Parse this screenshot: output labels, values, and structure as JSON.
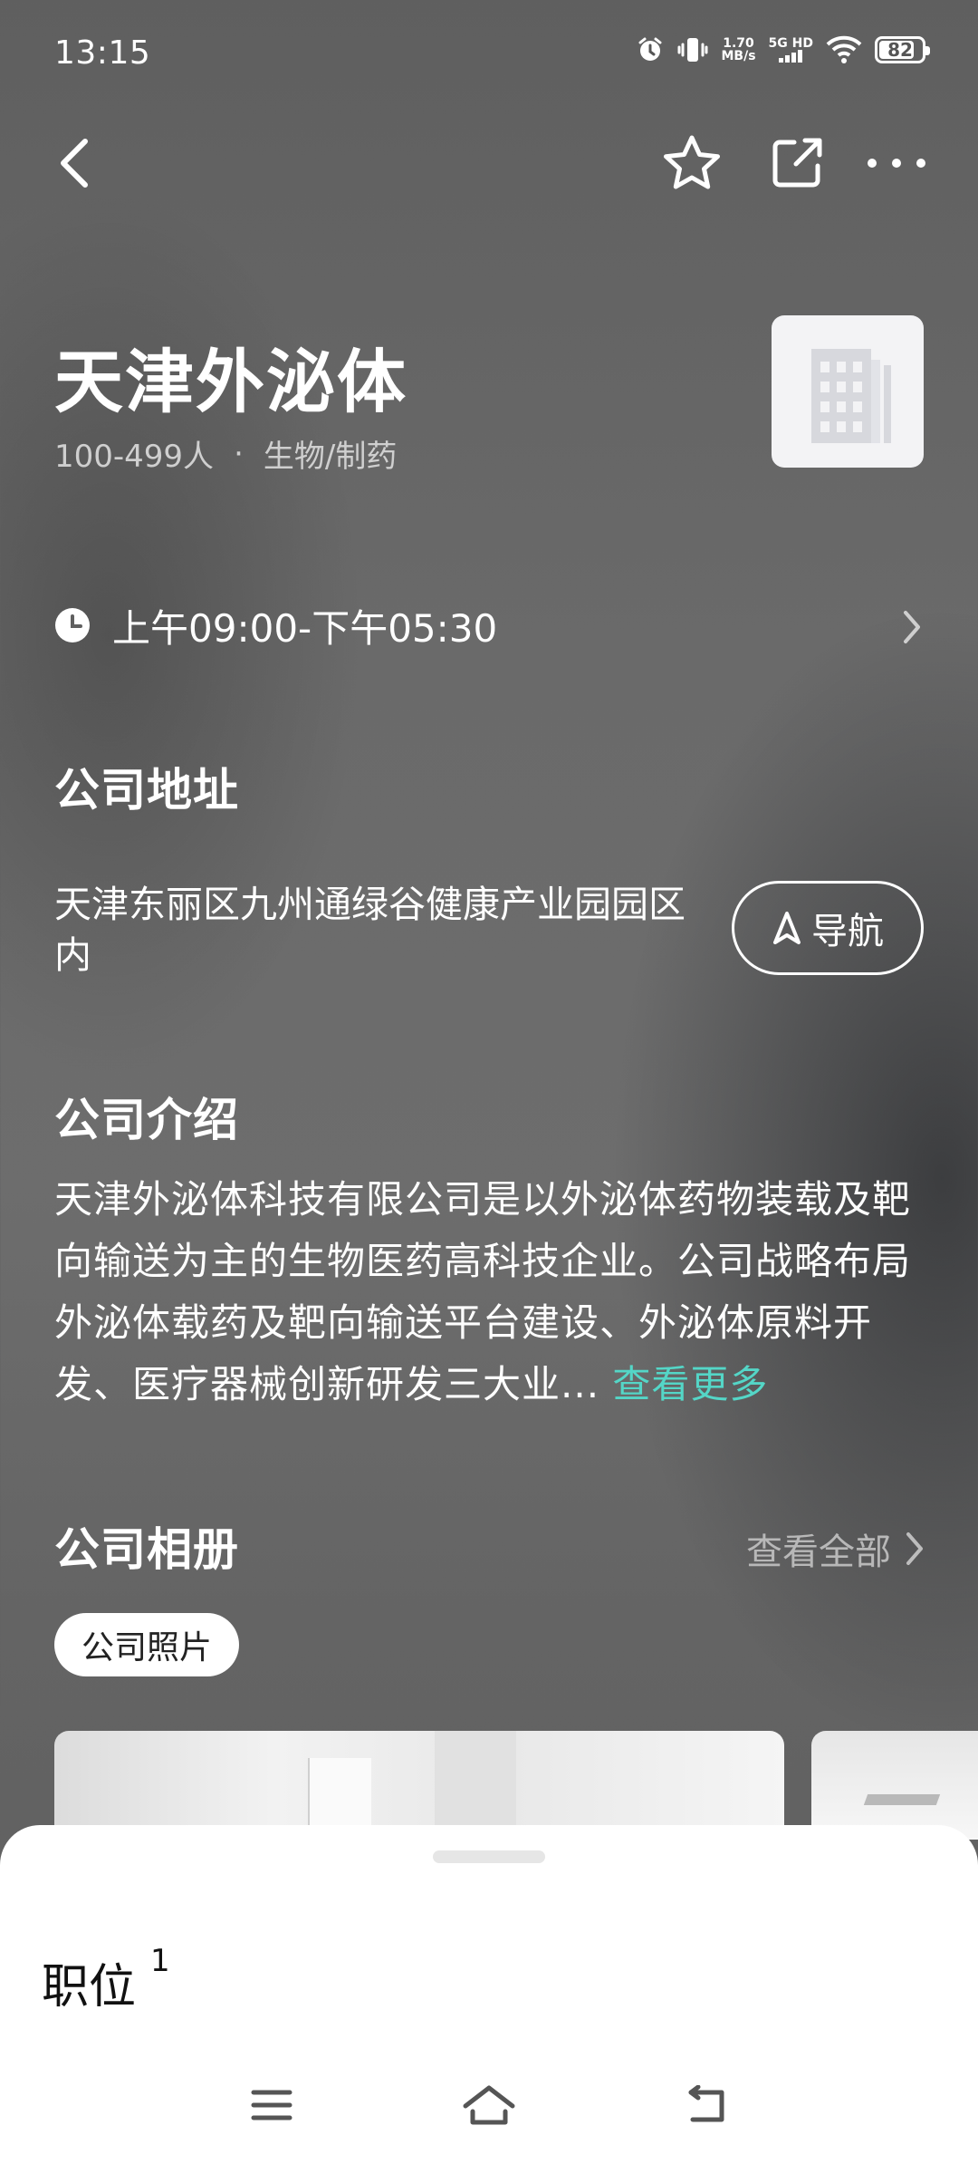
{
  "status_bar": {
    "time": "13:15",
    "net_speed_value": "1.70",
    "net_speed_unit": "MB/s",
    "network_type": "5G HD",
    "battery_level": "82",
    "battery_fraction": 0.82
  },
  "company": {
    "name": "天津外泌体",
    "size": "100-499人",
    "separator": "·",
    "industry": "生物/制药"
  },
  "hours": {
    "text": "上午09:00-下午05:30"
  },
  "address": {
    "title": "公司地址",
    "text": "天津东丽区九州通绿谷健康产业园园区内",
    "nav_label": "导航"
  },
  "intro": {
    "title": "公司介绍",
    "text": "天津外泌体科技有限公司是以外泌体药物装载及靶向输送为主的生物医药高科技企业。公司战略布局外泌体载药及靶向输送平台建设、外泌体原料开发、医疗器械创新研发三大业...",
    "more_label": "查看更多"
  },
  "album": {
    "title": "公司相册",
    "view_all_label": "查看全部",
    "tag": "公司照片"
  },
  "jobs": {
    "title": "职位",
    "count": "1"
  },
  "icons": {
    "back": "back-arrow-icon",
    "favorite": "star-icon",
    "share": "share-icon",
    "more": "more-dots-icon",
    "clock": "clock-icon",
    "navigate": "navigate-arrow-icon",
    "building": "building-icon",
    "menu": "menu-icon",
    "home": "home-icon",
    "back_nav": "back-nav-icon"
  },
  "colors": {
    "accent": "#54d6c7",
    "sheet": "#ffffff"
  }
}
